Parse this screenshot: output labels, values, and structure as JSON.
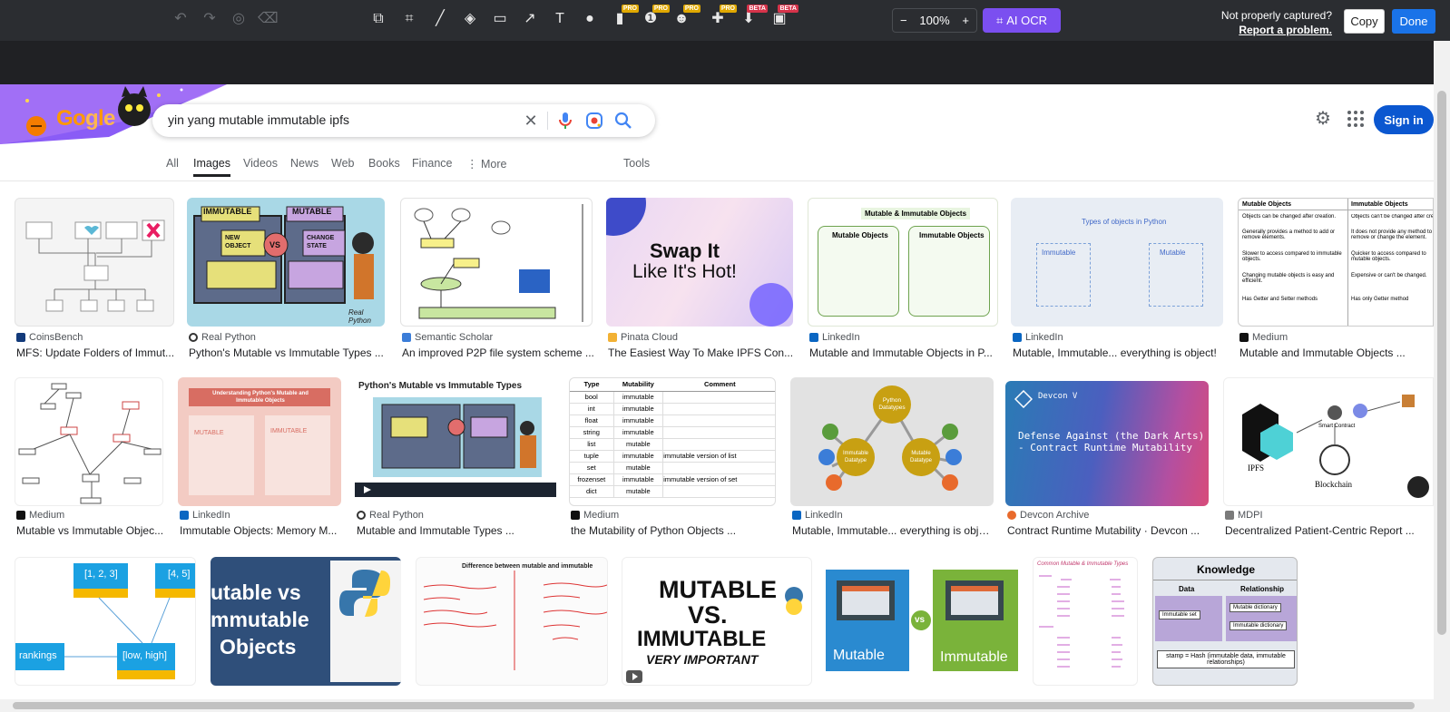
{
  "toolbar": {
    "zoom": "100%",
    "zoom_minus": "−",
    "zoom_plus": "+",
    "ocr_label": "AI OCR",
    "not_captured": "Not properly captured?",
    "report_link": "Report a problem.",
    "copy": "Copy",
    "done": "Done",
    "badge_pro": "PRO",
    "badge_beta": "BETA"
  },
  "search": {
    "query": "yin yang mutable immutable ipfs",
    "sign_in": "Sign in"
  },
  "tabs": [
    "All",
    "Images",
    "Videos",
    "News",
    "Web",
    "Books",
    "Finance",
    "More",
    "Tools"
  ],
  "results": [
    {
      "source": "CoinsBench",
      "title": "MFS: Update Folders of Immut..."
    },
    {
      "source": "Real Python",
      "title": "Python's Mutable vs Immutable Types ..."
    },
    {
      "source": "Semantic Scholar",
      "title": "An improved P2P file system scheme ..."
    },
    {
      "source": "Pinata Cloud",
      "title": "The Easiest Way To Make IPFS Con..."
    },
    {
      "source": "LinkedIn",
      "title": "Mutable and Immutable Objects in P..."
    },
    {
      "source": "LinkedIn",
      "title": "Mutable, Immutable... everything is object!"
    },
    {
      "source": "Medium",
      "title": "Mutable and Immutable Objects ..."
    },
    {
      "source": "Medium",
      "title": "Mutable vs Immutable Objec..."
    },
    {
      "source": "LinkedIn",
      "title": "Immutable Objects: Memory M..."
    },
    {
      "source": "Real Python",
      "title": "Mutable and Immutable Types ..."
    },
    {
      "source": "Medium",
      "title": "the Mutability of Python Objects ..."
    },
    {
      "source": "LinkedIn",
      "title": "Mutable, Immutable... everything is object!"
    },
    {
      "source": "Devcon Archive",
      "title": "Contract Runtime Mutability · Devcon ..."
    },
    {
      "source": "MDPI",
      "title": "Decentralized Patient-Centric Report ..."
    }
  ],
  "thumb_text": {
    "t2_immutable": "IMMUTABLE",
    "t2_mutable": "MUTABLE",
    "t2_new": "NEW OBJECT",
    "t2_vs": "VS",
    "t2_change": "CHANGE STATE",
    "t2_sig": "Real Python",
    "t4_line1": "Swap It",
    "t4_line2": "Like It's Hot!",
    "t5_title": "Mutable & Immutable Objects",
    "t5_mut": "Mutable Objects",
    "t5_imm": "Immutable Objects",
    "t6_title": "Types of objects in Python",
    "t6_imm": "Immutable",
    "t6_mut": "Mutable",
    "t7_h1": "Mutable Objects",
    "t7_h2": "Immutable Objects",
    "t7_r1a": "Objects can be changed after creation.",
    "t7_r1b": "Objects can't be changed after cre...",
    "t7_r2a": "Generally provides a method to add or remove elements.",
    "t7_r2b": "It does not provide any method to remove or change the element.",
    "t7_r3a": "Slower to access compared to immutable objects.",
    "t7_r3b": "Quicker to access compared to mutable objects.",
    "t7_r4a": "Changing mutable objects is easy and efficient.",
    "t7_r4b": "Expensive or can't be changed.",
    "t7_r5a": "Has Getter and Setter methods",
    "t7_r5b": "Has only Getter method",
    "t9_title": "Understanding Python's Mutable and Immutable Objects",
    "t9_mut": "MUTABLE",
    "t9_imm": "IMMUTABLE",
    "t10_title": "Python's Mutable vs Immutable Types",
    "t11_h1": "Type",
    "t11_h2": "Mutability",
    "t11_h3": "Comment",
    "t12_py": "Python Datatypes",
    "t12_imm": "Immutable Datatype",
    "t12_mut": "Mutable Datatype",
    "t13_title": "Devcon V",
    "t13_sub": "Defense Against (the Dark Arts) - Contract Runtime Mutability",
    "t14_ipfs": "IPFS",
    "t14_bc": "Blockchain",
    "t14_sc": "Smart Contract",
    "t15_a": "[1, 2, 3]",
    "t15_b": "[4, 5]",
    "t15_c": "rankings",
    "t15_d": "[low, high]",
    "t16_a": "utable vs",
    "t16_b": "mmutable",
    "t16_c": "Objects",
    "t17_title": "Difference between mutable and immutable",
    "t18_a": "MUTABLE",
    "t18_b": "VS.",
    "t18_c": "IMMUTABLE",
    "t18_d": "VERY IMPORTANT",
    "t19_a": "Mutable",
    "t19_b": "Immutable",
    "t19_vs": "vs",
    "t20_title": "Common Mutable & Immutable Types",
    "t21_title": "Knowledge",
    "t21_data": "Data",
    "t21_rel": "Relationship",
    "t21_set": "Immutable set",
    "t21_md": "Mutable dictionary",
    "t21_id": "Immutable dictionary",
    "t21_stamp": "stamp = Hash (immutable data, immutable relationships)"
  },
  "type_table": [
    [
      "bool",
      "immutable",
      ""
    ],
    [
      "int",
      "immutable",
      ""
    ],
    [
      "float",
      "immutable",
      ""
    ],
    [
      "string",
      "immutable",
      ""
    ],
    [
      "list",
      "mutable",
      ""
    ],
    [
      "tuple",
      "immutable",
      "immutable version of list"
    ],
    [
      "set",
      "mutable",
      ""
    ],
    [
      "frozenset",
      "immutable",
      "immutable version of set"
    ],
    [
      "dict",
      "mutable",
      ""
    ]
  ]
}
